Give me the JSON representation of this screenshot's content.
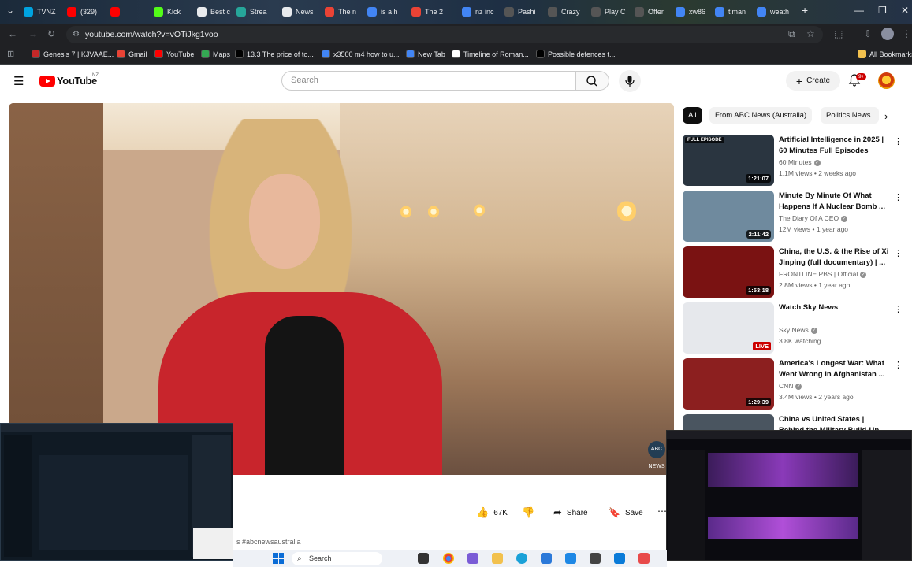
{
  "browser": {
    "tabs": [
      {
        "label": "TVNZ",
        "color": "#00a3e0"
      },
      {
        "label": "(329)",
        "color": "#ff0000"
      },
      {
        "label": "",
        "color": "#ff0000"
      },
      {
        "label": "Kick",
        "color": "#53fc18"
      },
      {
        "label": "Best c",
        "color": "#e8eaed"
      },
      {
        "label": "Strea",
        "color": "#26a69a"
      },
      {
        "label": "News",
        "color": "#e8eaed"
      },
      {
        "label": "The n",
        "color": "#ea4335"
      },
      {
        "label": "is a h",
        "color": "#4285f4"
      },
      {
        "label": "The 2",
        "color": "#ea4335"
      },
      {
        "label": "nz inc",
        "color": "#4285f4"
      },
      {
        "label": "Pashi",
        "color": "#555555"
      },
      {
        "label": "Crazy",
        "color": "#555555"
      },
      {
        "label": "Play C",
        "color": "#555555"
      },
      {
        "label": "Offer",
        "color": "#555555"
      },
      {
        "label": "xw86",
        "color": "#4285f4"
      },
      {
        "label": "timan",
        "color": "#4285f4"
      },
      {
        "label": "weath",
        "color": "#4285f4"
      }
    ],
    "new_tab": "+",
    "url": "youtube.com/watch?v=vOTiJkg1voo",
    "bookmarks": [
      {
        "label": "Genesis 7 | KJVAAE...",
        "color": "#c62828"
      },
      {
        "label": "Gmail",
        "color": "#ea4335"
      },
      {
        "label": "YouTube",
        "color": "#ff0000"
      },
      {
        "label": "Maps",
        "color": "#34a853"
      },
      {
        "label": "13.3 The price of to...",
        "color": "#000000"
      },
      {
        "label": "x3500 m4 how to u...",
        "color": "#4285f4"
      },
      {
        "label": "New Tab",
        "color": "#4285f4"
      },
      {
        "label": "Timeline of Roman...",
        "color": "#ffffff"
      },
      {
        "label": "Possible defences t...",
        "color": "#000000"
      }
    ],
    "all_bookmarks": "All Bookmarks"
  },
  "youtube": {
    "logo_text": "YouTube",
    "region": "NZ",
    "search_placeholder": "Search",
    "create_label": "Create",
    "notifications": "9+",
    "actions": {
      "likes": "67K",
      "share": "Share",
      "save": "Save"
    },
    "hashtag": "s #abcnewsaustralia",
    "watermark": "ABC NEWS",
    "chips": [
      "All",
      "From ABC News (Australia)",
      "Politics News"
    ],
    "recommendations": [
      {
        "title": "Artificial Intelligence in 2025 | 60 Minutes Full Episodes",
        "channel": "60 Minutes",
        "verified": true,
        "meta": "1.1M views • 2 weeks ago",
        "duration": "1:21:07",
        "badge": "FULL EPISODE",
        "thumb_color": "#2a3540"
      },
      {
        "title": "Minute By Minute Of What Happens If A Nuclear Bomb ...",
        "channel": "The Diary Of A CEO",
        "verified": true,
        "meta": "12M views • 1 year ago",
        "duration": "2:11:42",
        "badge": "",
        "thumb_color": "#6f8a9e"
      },
      {
        "title": "China, the U.S. & the Rise of Xi Jinping (full documentary) | ...",
        "channel": "FRONTLINE PBS | Official",
        "verified": true,
        "meta": "2.8M views • 1 year ago",
        "duration": "1:53:18",
        "badge": "",
        "thumb_color": "#7a1212"
      },
      {
        "title": "Watch Sky News",
        "channel": "Sky News",
        "verified": true,
        "meta": "3.8K watching",
        "duration": "LIVE",
        "badge": "",
        "thumb_color": "#e6e8ec"
      },
      {
        "title": "America's Longest War: What Went Wrong in Afghanistan ...",
        "channel": "CNN",
        "verified": true,
        "meta": "3.4M views • 2 years ago",
        "duration": "1:29:39",
        "badge": "",
        "thumb_color": "#8c1f1f"
      },
      {
        "title": "China vs United States | Behind the Military Build-Up",
        "channel": "",
        "verified": false,
        "meta": "",
        "duration": "",
        "badge": "",
        "thumb_color": "#4a5560"
      }
    ]
  },
  "taskbar": {
    "search_label": "Search"
  }
}
